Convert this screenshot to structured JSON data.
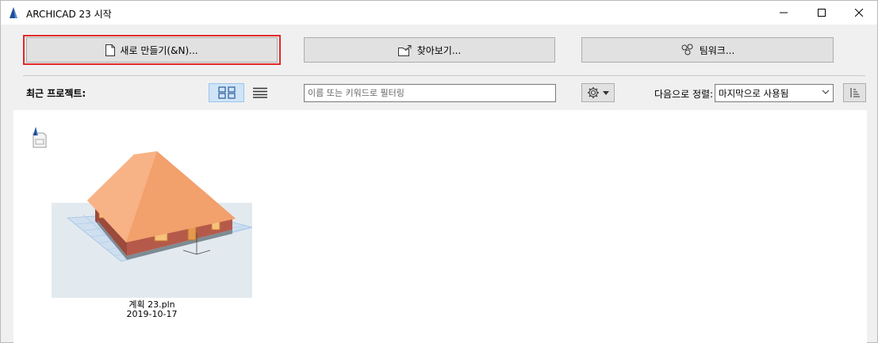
{
  "window": {
    "title": "ARCHICAD 23 시작"
  },
  "actions": {
    "new_label": "새로 만들기(&N)...",
    "browse_label": "찾아보기...",
    "teamwork_label": "팀워크..."
  },
  "toolbar": {
    "recent_label": "최근 프로젝트:",
    "filter_placeholder": "이름 또는 키워드로 필터링",
    "sort_label": "다음으로 정렬:",
    "sort_value": "마지막으로 사용됨"
  },
  "recent_projects": [
    {
      "name": "계획 23.pln",
      "date": "2019-10-17"
    }
  ],
  "colors": {
    "highlight_border": "#e02a2a",
    "roof": "#f4a574",
    "brick": "#b55a4a",
    "ground_grid": "#a9c8e6",
    "active_view": "#cfe4f7"
  }
}
